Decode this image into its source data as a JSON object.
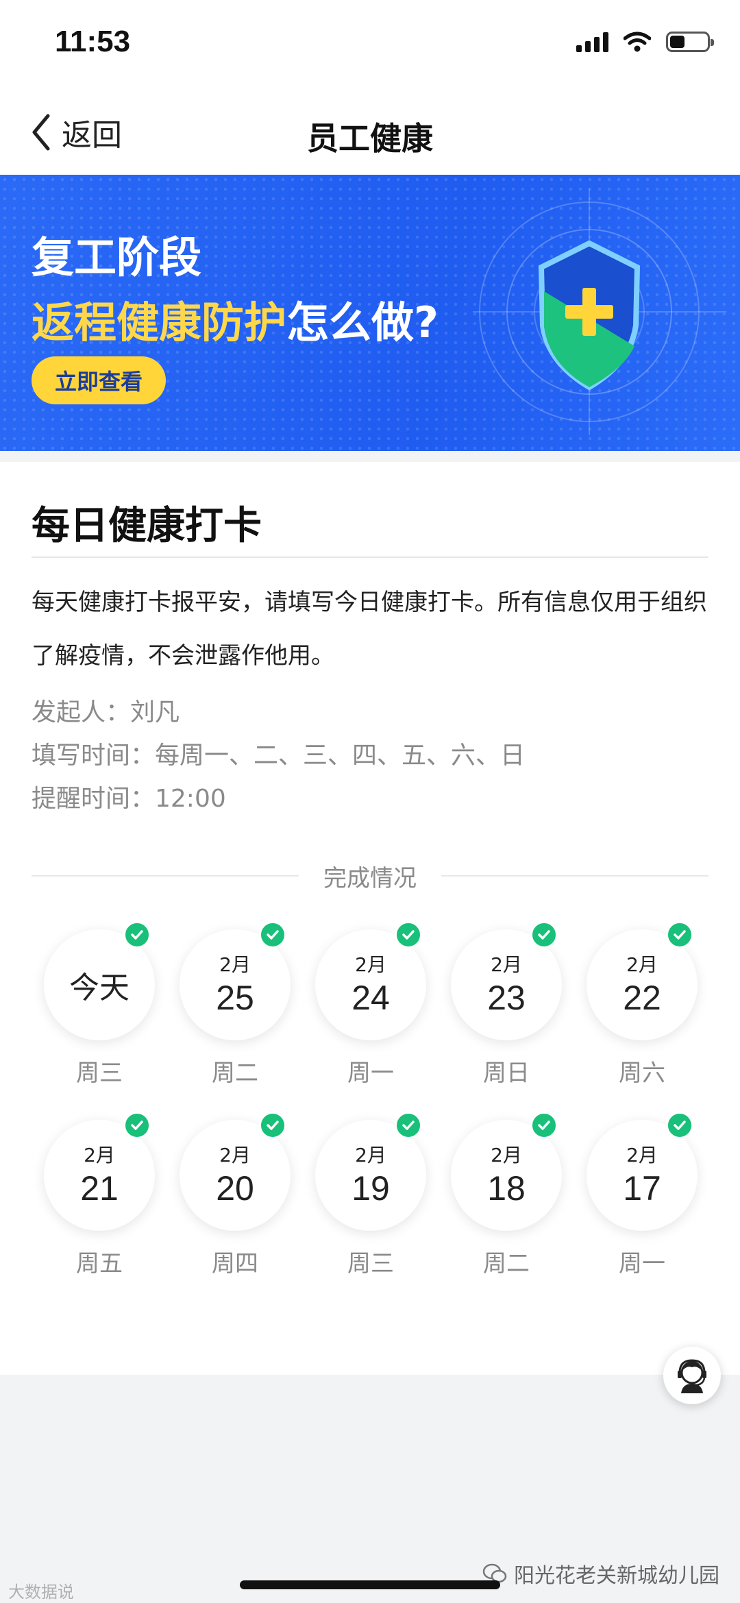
{
  "status_bar": {
    "time": "11:53",
    "icons": [
      "signal-icon",
      "wifi-icon",
      "battery-icon"
    ]
  },
  "nav": {
    "back_label": "返回",
    "title": "员工健康"
  },
  "banner": {
    "line1": "复工阶段",
    "line2_highlight": "返程健康防护",
    "line2_rest": "怎么做?",
    "button_label": "立即查看",
    "colors": {
      "background": "#1f5cf0",
      "highlight": "#ffd84a",
      "button": "#ffd539"
    }
  },
  "checkin": {
    "title": "每日健康打卡",
    "description": "每天健康打卡报平安，请填写今日健康打卡。所有信息仅用于组织了解疫情，不会泄露作他用。",
    "sponsor": "发起人：刘凡",
    "fill_time": "填写时间：每周一、二、三、四、五、六、日",
    "remind_time": "提醒时间：12:00",
    "section_title": "完成情况",
    "days": [
      {
        "month": "",
        "day": "今天",
        "weekday": "周三",
        "completed": true
      },
      {
        "month": "2月",
        "day": "25",
        "weekday": "周二",
        "completed": true
      },
      {
        "month": "2月",
        "day": "24",
        "weekday": "周一",
        "completed": true
      },
      {
        "month": "2月",
        "day": "23",
        "weekday": "周日",
        "completed": true
      },
      {
        "month": "2月",
        "day": "22",
        "weekday": "周六",
        "completed": true
      },
      {
        "month": "2月",
        "day": "21",
        "weekday": "周五",
        "completed": true
      },
      {
        "month": "2月",
        "day": "20",
        "weekday": "周四",
        "completed": true
      },
      {
        "month": "2月",
        "day": "19",
        "weekday": "周三",
        "completed": true
      },
      {
        "month": "2月",
        "day": "18",
        "weekday": "周二",
        "completed": true
      },
      {
        "month": "2月",
        "day": "17",
        "weekday": "周一",
        "completed": true
      }
    ],
    "check_color": "#18c07a"
  },
  "watermarks": {
    "left": "大数据说",
    "right": "阳光花老关新城幼儿园"
  }
}
